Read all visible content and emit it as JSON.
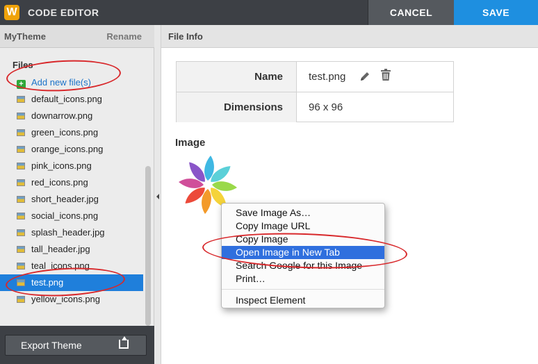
{
  "app": {
    "logo": "W",
    "title": "CODE EDITOR",
    "cancel_label": "CANCEL",
    "save_label": "SAVE"
  },
  "sidebar": {
    "theme_name": "MyTheme",
    "rename_label": "Rename",
    "files_label": "Files",
    "add_files_label": "Add new file(s)",
    "files": [
      {
        "name": "default_icons.png",
        "selected": false
      },
      {
        "name": "downarrow.png",
        "selected": false
      },
      {
        "name": "green_icons.png",
        "selected": false
      },
      {
        "name": "orange_icons.png",
        "selected": false
      },
      {
        "name": "pink_icons.png",
        "selected": false
      },
      {
        "name": "red_icons.png",
        "selected": false
      },
      {
        "name": "short_header.jpg",
        "selected": false
      },
      {
        "name": "social_icons.png",
        "selected": false
      },
      {
        "name": "splash_header.jpg",
        "selected": false
      },
      {
        "name": "tall_header.jpg",
        "selected": false
      },
      {
        "name": "teal_icons.png",
        "selected": false
      },
      {
        "name": "test.png",
        "selected": true
      },
      {
        "name": "yellow_icons.png",
        "selected": false
      }
    ],
    "export_label": "Export Theme"
  },
  "main": {
    "title": "File Info",
    "name_label": "Name",
    "name_value": "test.png",
    "dimensions_label": "Dimensions",
    "dimensions_value": "96 x 96",
    "image_label": "Image"
  },
  "context_menu": {
    "items": [
      {
        "label": "Save Image As…",
        "highlighted": false
      },
      {
        "label": "Copy Image URL",
        "highlighted": false
      },
      {
        "label": "Copy Image",
        "highlighted": false
      },
      {
        "label": "Open Image in New Tab",
        "highlighted": true
      },
      {
        "label": "Search Google for this Image",
        "highlighted": false
      },
      {
        "label": "Print…",
        "highlighted": false
      },
      {
        "label": "Inspect Element",
        "highlighted": false
      }
    ]
  },
  "colors": {
    "accent": "#1e8fe0",
    "selection": "#1f7fdb",
    "annotation": "#d8282b",
    "topbar": "#3d4045"
  },
  "icons": [
    "logo-icon",
    "plus-icon",
    "file-icon",
    "pencil-icon",
    "trash-icon",
    "upload-icon",
    "collapse-arrow-icon"
  ]
}
